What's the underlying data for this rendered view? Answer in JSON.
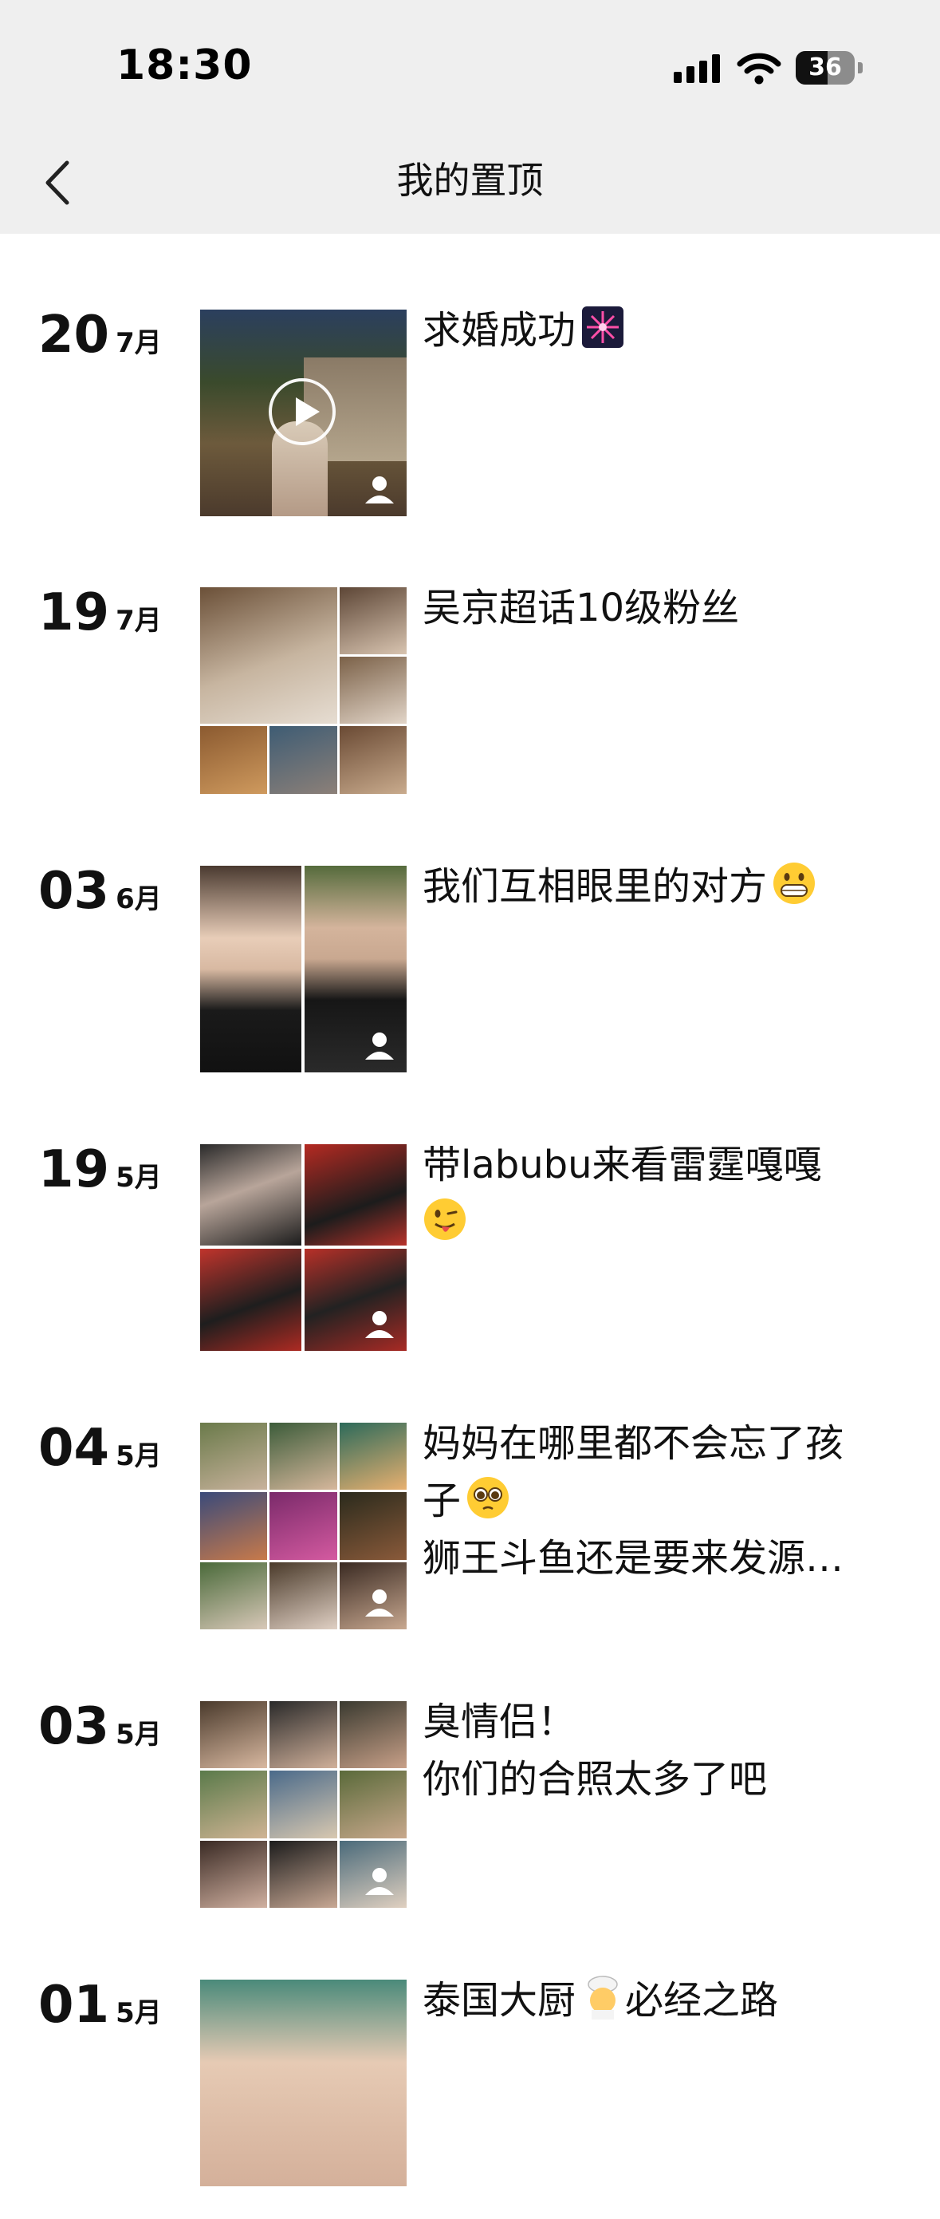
{
  "status_bar": {
    "time": "18:30",
    "battery": "36"
  },
  "nav": {
    "title": "我的置顶"
  },
  "posts": [
    {
      "day": "20",
      "month": "7月",
      "lines": [
        "求婚成功"
      ],
      "emoji": "fireworks-emoji",
      "media": "video"
    },
    {
      "day": "19",
      "month": "7月",
      "lines": [
        "吴京超话10级粉丝"
      ],
      "emoji": "",
      "media": "grid-7"
    },
    {
      "day": "03",
      "month": "6月",
      "lines": [
        "我们互相眼里的对方"
      ],
      "emoji": "grinning-emoji",
      "media": "grid-2"
    },
    {
      "day": "19",
      "month": "5月",
      "lines": [
        "带labubu来看雷霆嘎嘎",
        ""
      ],
      "emoji": "winking-tongue-emoji",
      "media": "grid-4"
    },
    {
      "day": "04",
      "month": "5月",
      "lines": [
        "妈妈在哪里都不会忘了孩",
        "子",
        "狮王斗鱼还是要来发源…"
      ],
      "emoji": "pleading-emoji",
      "media": "grid-9"
    },
    {
      "day": "03",
      "month": "5月",
      "lines": [
        "臭情侣！",
        "你们的合照太多了吧"
      ],
      "emoji": "",
      "media": "grid-9"
    },
    {
      "day": "01",
      "month": "5月",
      "lines": [
        "泰国大厨",
        "必经之路"
      ],
      "emoji": "cook-emoji",
      "media": "single"
    }
  ],
  "colors": {
    "header_bg": "#efefef",
    "text": "#111111",
    "background": "#ffffff"
  }
}
